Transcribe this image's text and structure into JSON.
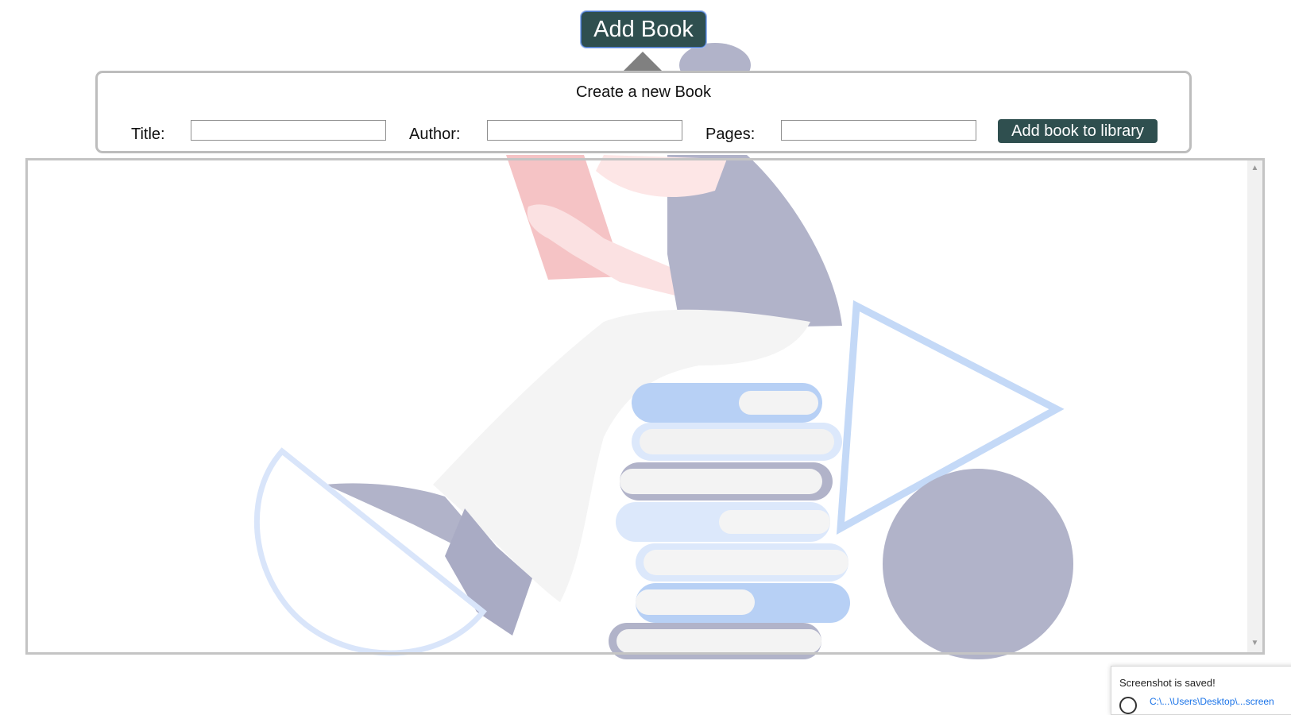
{
  "header": {
    "add_book_label": "Add Book"
  },
  "form": {
    "title": "Create a new Book",
    "title_label": "Title:",
    "author_label": "Author:",
    "pages_label": "Pages:",
    "title_value": "",
    "author_value": "",
    "pages_value": "",
    "submit_label": "Add book to library"
  },
  "library": {
    "scroll_up_icon": "triangle-up-icon",
    "scroll_down_icon": "triangle-down-icon"
  },
  "toast": {
    "message": "Screenshot is saved!",
    "link": "C:\\...\\Users\\Desktop\\...screen"
  },
  "colors": {
    "accent": "#2f4f4f",
    "panel_border": "#bdbdbd",
    "illustration_blue": "#b7d0f5",
    "illustration_purple": "#b1b3c9",
    "illustration_pink": "#f5b8bb"
  }
}
